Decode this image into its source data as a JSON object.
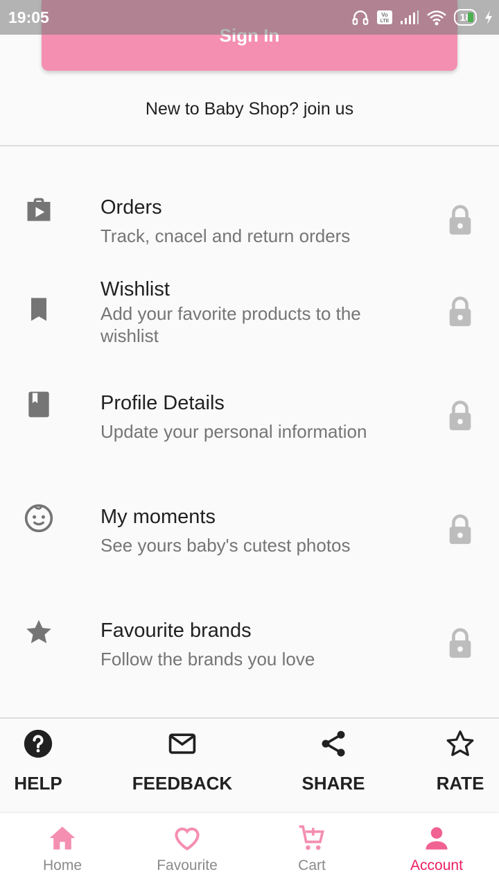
{
  "status_bar": {
    "time": "19:05",
    "battery": "18",
    "icons": [
      "headphones-icon",
      "volte-icon",
      "signal-icon",
      "wifi-icon",
      "battery-icon",
      "charging-icon"
    ]
  },
  "signin": {
    "label": "Sign In"
  },
  "join_text": "New to Baby Shop? join us",
  "menu": [
    {
      "title": "Orders",
      "subtitle": "Track, cnacel and return orders",
      "icon": "shopping-bag-play-icon"
    },
    {
      "title": "Wishlist",
      "subtitle": "Add your favorite products to the wishlist",
      "icon": "bookmark-icon"
    },
    {
      "title": "Profile Details",
      "subtitle": "Update your personal information",
      "icon": "book-icon"
    },
    {
      "title": "My moments",
      "subtitle": "See yours baby's cutest photos",
      "icon": "baby-face-icon"
    },
    {
      "title": "Favourite brands",
      "subtitle": "Follow the brands you love",
      "icon": "star-icon"
    }
  ],
  "actions": [
    {
      "label": "HELP",
      "icon": "help-icon"
    },
    {
      "label": "FEEDBACK",
      "icon": "mail-icon"
    },
    {
      "label": "SHARE",
      "icon": "share-icon"
    },
    {
      "label": "RATE",
      "icon": "star-outline-icon"
    }
  ],
  "bottom_nav": [
    {
      "label": "Home",
      "icon": "home-icon"
    },
    {
      "label": "Favourite",
      "icon": "heart-icon"
    },
    {
      "label": "Cart",
      "icon": "cart-icon"
    },
    {
      "label": "Account",
      "icon": "account-icon",
      "active": true
    }
  ],
  "colors": {
    "primary_pink": "#f48fb1",
    "accent": "#e91e63",
    "icon_gray": "#757575",
    "lock_gray": "#bdbdbd"
  }
}
